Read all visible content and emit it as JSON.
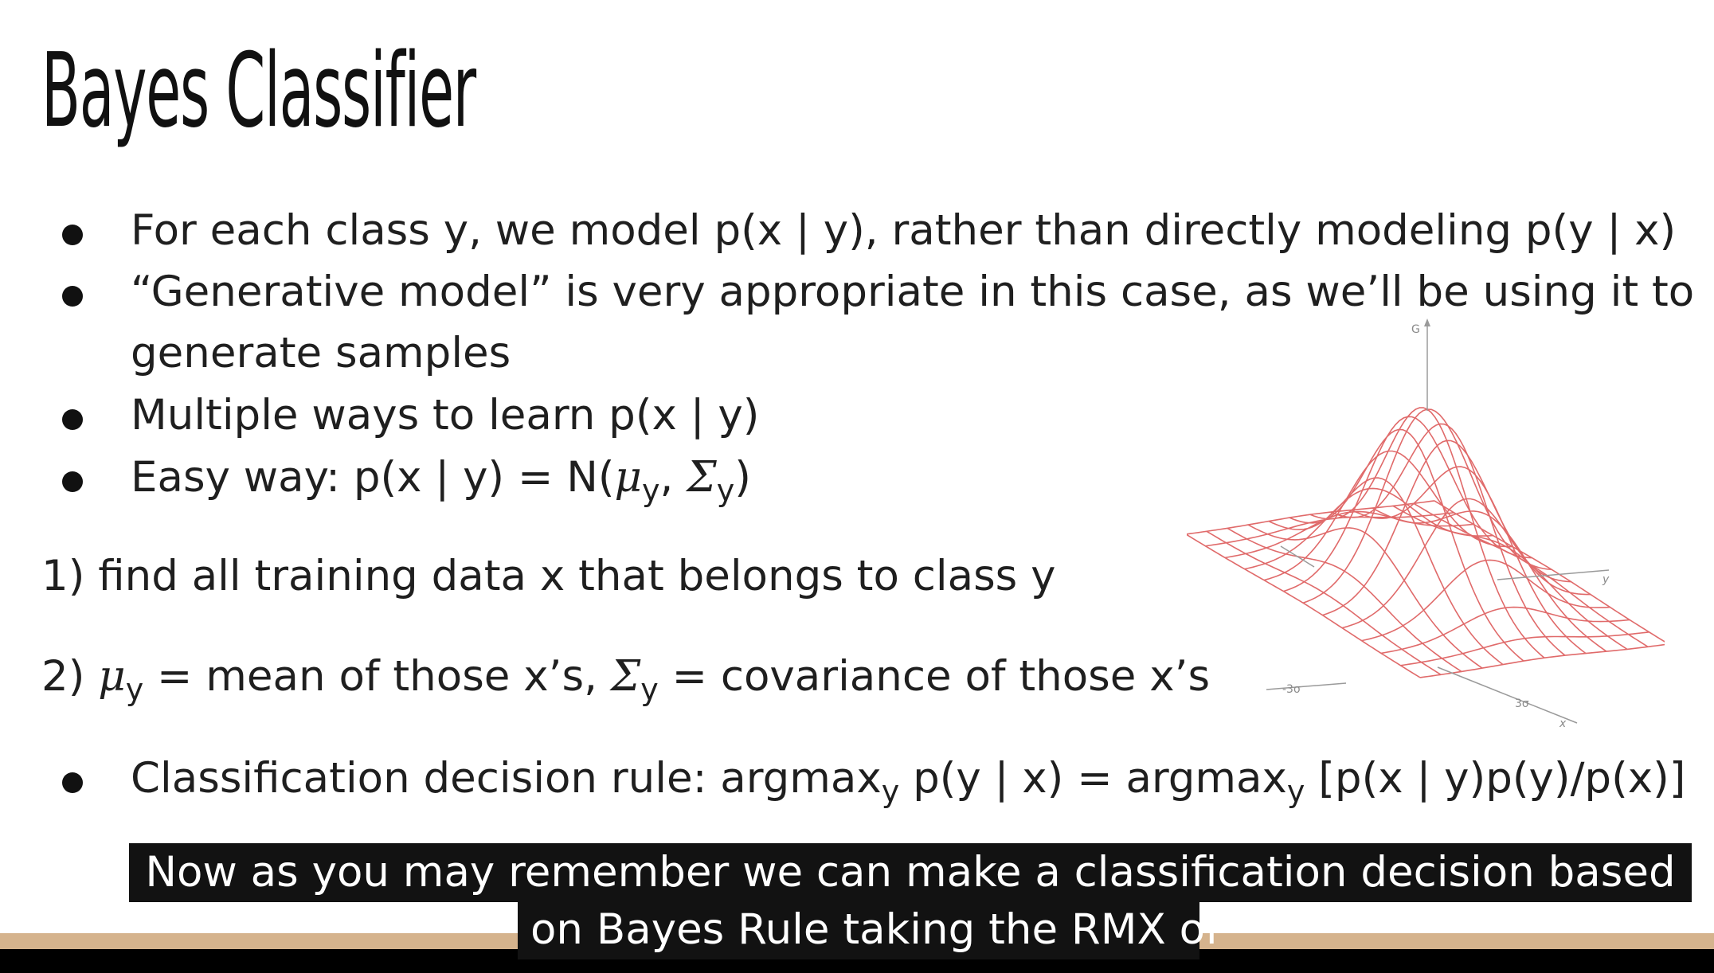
{
  "slide": {
    "title": "Bayes Classifier",
    "bullets": [
      {
        "text": "For each class y, we model p(x | y), rather than directly modeling p(y | x)"
      },
      {
        "line1": "“Generative model” is very appropriate in this case, as we’ll be using it to",
        "line2": "generate samples"
      },
      {
        "text": "Multiple ways to learn p(x | y)"
      },
      {
        "prefix": "Easy way: p(x | y) = N(",
        "mu": "μ",
        "sub1": "y",
        "sep": ", ",
        "sigma": "Σ",
        "sub2": "y",
        "suffix": ")"
      }
    ],
    "step1": "1) find all training data x that belongs to class y",
    "step2": {
      "prefix": "2) ",
      "mu": "μ",
      "sub1": "y",
      "mid": " = mean of those x’s, ",
      "sigma": "Σ",
      "sub2": "y",
      "suffix": " = covariance of those x’s"
    },
    "rule": {
      "a": "Classification decision rule: argmax",
      "sub1": "y",
      "b": " p(y | x) = argmax",
      "sub2": "y",
      "c": " [p(x | y)p(y)/p(x)]"
    }
  },
  "graphic": {
    "z_label": "G",
    "y_label": "y",
    "x_label": "x",
    "neg_label": "-3σ",
    "pos_label": "3σ",
    "line_color": "#e06a6a"
  },
  "caption": {
    "line1": "Now as you may remember we can make a classification decision based",
    "line2": "on Bayes Rule taking the RMX of"
  }
}
